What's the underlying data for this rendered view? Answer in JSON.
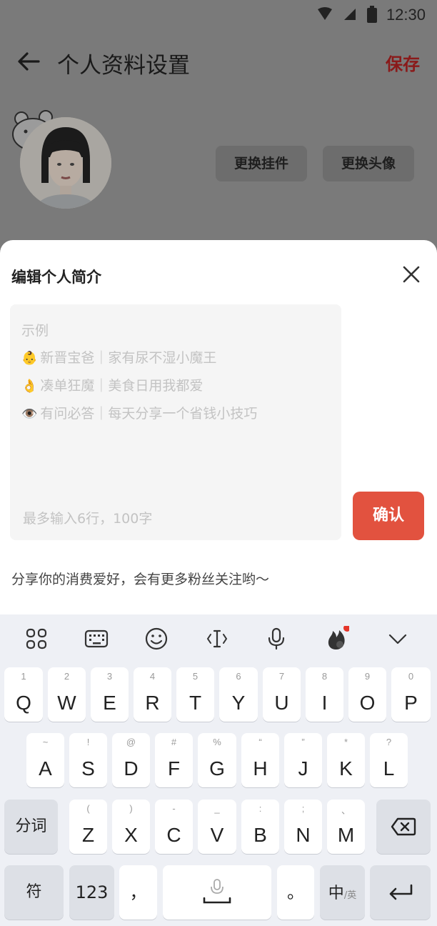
{
  "status_bar": {
    "time": "12:30"
  },
  "header": {
    "title": "个人资料设置",
    "save_label": "保存"
  },
  "profile": {
    "change_widget_label": "更换挂件",
    "change_avatar_label": "更换头像"
  },
  "sheet": {
    "title": "编辑个人简介",
    "example_heading": "示例",
    "examples": [
      {
        "emoji": "👶",
        "text": "新晋宝爸｜家有尿不湿小魔王"
      },
      {
        "emoji": "👌",
        "text": "凑单狂魔｜美食日用我都爱"
      },
      {
        "emoji": "👁️",
        "text": "有问必答｜每天分享一个省钱小技巧"
      }
    ],
    "input_hint": "最多输入6行，100字",
    "confirm_label": "确认",
    "tip": "分享你的消费爱好，会有更多粉丝关注哟～"
  },
  "keyboard": {
    "row1": [
      {
        "main": "Q",
        "sub": "1"
      },
      {
        "main": "W",
        "sub": "2"
      },
      {
        "main": "E",
        "sub": "3"
      },
      {
        "main": "R",
        "sub": "4"
      },
      {
        "main": "T",
        "sub": "5"
      },
      {
        "main": "Y",
        "sub": "6"
      },
      {
        "main": "U",
        "sub": "7"
      },
      {
        "main": "I",
        "sub": "8"
      },
      {
        "main": "O",
        "sub": "9"
      },
      {
        "main": "P",
        "sub": "0"
      }
    ],
    "row2": [
      {
        "main": "A",
        "sub": "~"
      },
      {
        "main": "S",
        "sub": "!"
      },
      {
        "main": "D",
        "sub": "@"
      },
      {
        "main": "F",
        "sub": "#"
      },
      {
        "main": "G",
        "sub": "%"
      },
      {
        "main": "H",
        "sub": "“"
      },
      {
        "main": "J",
        "sub": "”"
      },
      {
        "main": "K",
        "sub": "*"
      },
      {
        "main": "L",
        "sub": "?"
      }
    ],
    "row3": [
      {
        "main": "Z",
        "sub": "("
      },
      {
        "main": "X",
        "sub": ")"
      },
      {
        "main": "C",
        "sub": "-"
      },
      {
        "main": "V",
        "sub": "_"
      },
      {
        "main": "B",
        "sub": ":"
      },
      {
        "main": "N",
        "sub": ";"
      },
      {
        "main": "M",
        "sub": "、"
      }
    ],
    "fenci_label": "分词",
    "symbols_label": "符",
    "numbers_label": "123",
    "comma_label": "，",
    "period_label": "。",
    "lang_main": "中",
    "lang_sub": "/英"
  },
  "colors": {
    "accent": "#e2523f",
    "save": "#8a1a1a",
    "notification_dot": "#e5352a"
  },
  "icons": {
    "toolbar": [
      "apps-icon",
      "keyboard-icon",
      "emoji-icon",
      "cursor-icon",
      "microphone-icon",
      "fire-icon",
      "chevron-down-icon"
    ]
  }
}
